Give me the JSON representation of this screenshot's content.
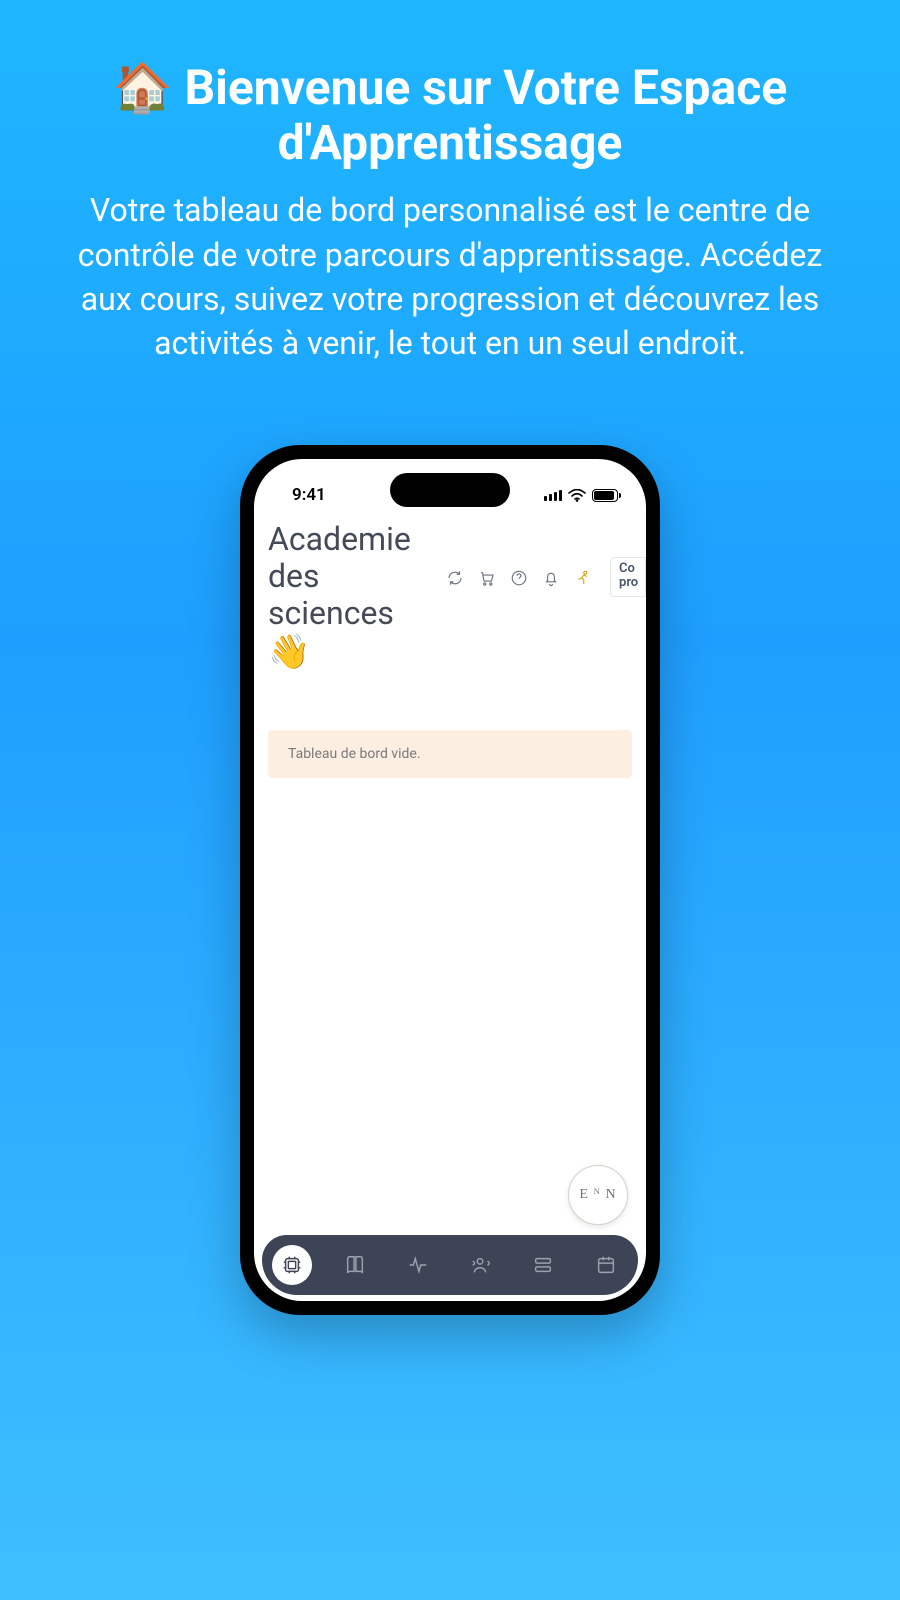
{
  "hero": {
    "icon": "🏠",
    "title": "Bienvenue sur Votre Espace d'Apprentissage",
    "description": "Votre tableau de bord personnalisé est le centre de contrôle de votre parcours d'apprentissage. Accédez aux cours, suivez votre progression et découvrez les activités à venir, le tout en un seul endroit."
  },
  "statusbar": {
    "time": "9:41"
  },
  "app": {
    "title": "Academie des sciences",
    "wave": "👋",
    "notice": "Tableau de bord vide.",
    "badge_line1": "Co",
    "badge_line2": "pro",
    "fab": "E ᴺ N"
  }
}
